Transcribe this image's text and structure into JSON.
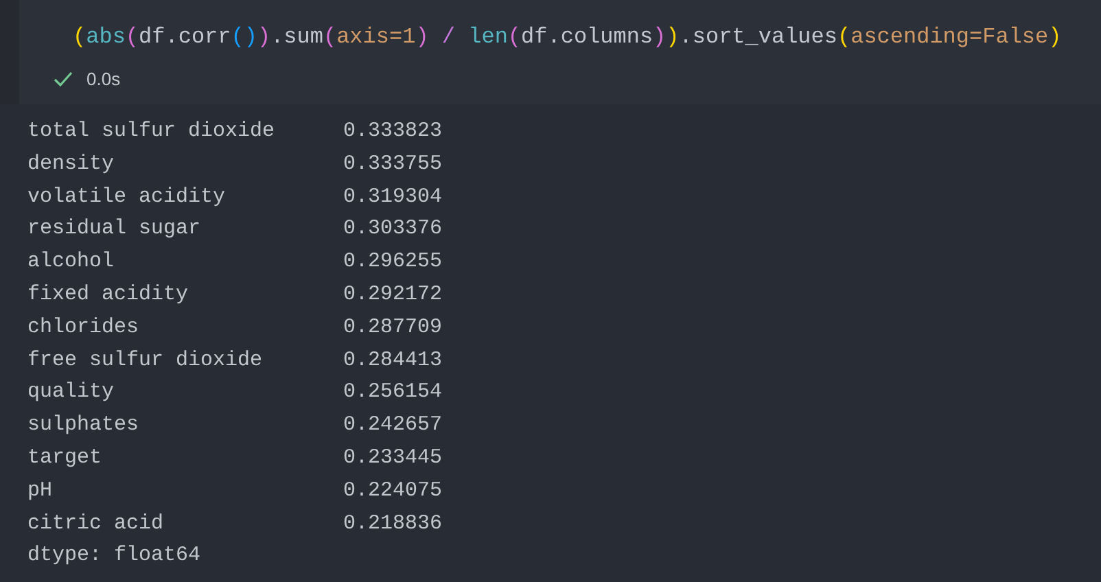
{
  "cell": {
    "code_tokens": [
      {
        "text": "(",
        "kind": "bracket1"
      },
      {
        "text": "abs",
        "kind": "builtin"
      },
      {
        "text": "(",
        "kind": "bracket2"
      },
      {
        "text": "df.corr",
        "kind": "plain"
      },
      {
        "text": "()",
        "kind": "bracket3"
      },
      {
        "text": ")",
        "kind": "bracket2"
      },
      {
        "text": ".sum",
        "kind": "plain"
      },
      {
        "text": "(",
        "kind": "bracket2"
      },
      {
        "text": "axis=1",
        "kind": "param"
      },
      {
        "text": ")",
        "kind": "bracket2"
      },
      {
        "text": " / ",
        "kind": "operator"
      },
      {
        "text": "len",
        "kind": "builtin"
      },
      {
        "text": "(",
        "kind": "bracket2"
      },
      {
        "text": "df.columns",
        "kind": "plain"
      },
      {
        "text": ")",
        "kind": "bracket2"
      },
      {
        "text": ")",
        "kind": "bracket1"
      },
      {
        "text": ".sort_values",
        "kind": "plain"
      },
      {
        "text": "(",
        "kind": "bracket1"
      },
      {
        "text": "ascending=False",
        "kind": "param"
      },
      {
        "text": ")",
        "kind": "bracket1"
      }
    ],
    "status": {
      "succeeded": true,
      "duration": "0.0s"
    }
  },
  "output": {
    "rows": [
      {
        "name": "total sulfur dioxide",
        "value": "0.333823"
      },
      {
        "name": "density",
        "value": "0.333755"
      },
      {
        "name": "volatile acidity",
        "value": "0.319304"
      },
      {
        "name": "residual sugar",
        "value": "0.303376"
      },
      {
        "name": "alcohol",
        "value": "0.296255"
      },
      {
        "name": "fixed acidity",
        "value": "0.292172"
      },
      {
        "name": "chlorides",
        "value": "0.287709"
      },
      {
        "name": "free sulfur dioxide",
        "value": "0.284413"
      },
      {
        "name": "quality",
        "value": "0.256154"
      },
      {
        "name": "sulphates",
        "value": "0.242657"
      },
      {
        "name": "target",
        "value": "0.233445"
      },
      {
        "name": "pH",
        "value": "0.224075"
      },
      {
        "name": "citric acid",
        "value": "0.218836"
      }
    ],
    "dtype": "dtype: float64"
  }
}
